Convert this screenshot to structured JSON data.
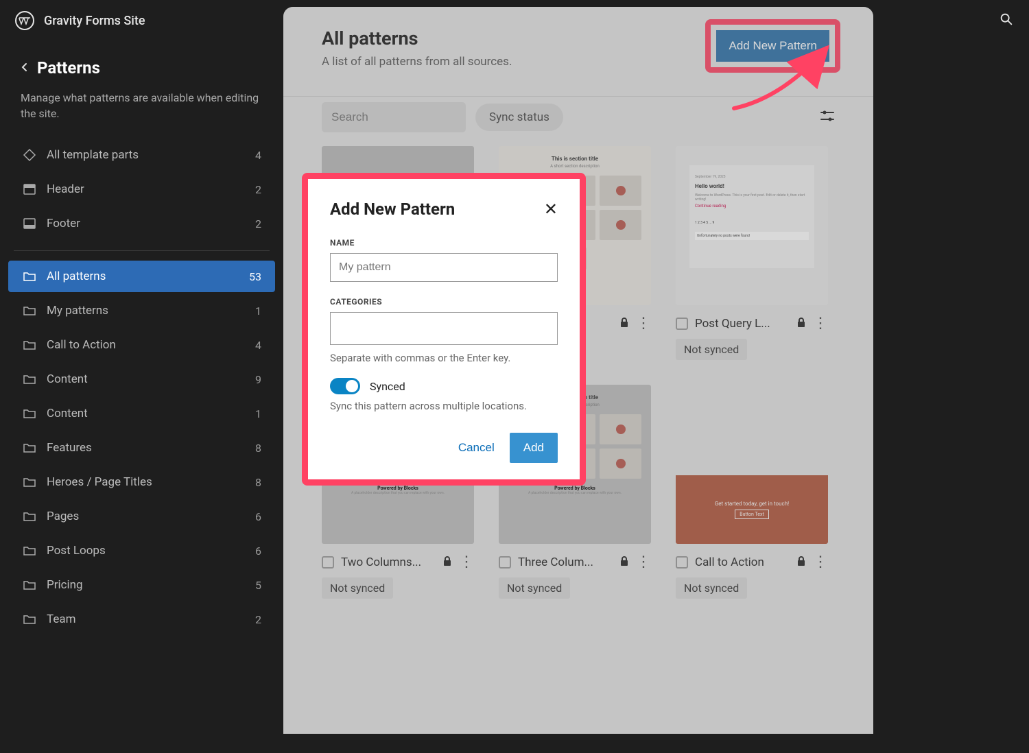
{
  "topbar": {
    "site_title": "Gravity Forms Site"
  },
  "sidebar": {
    "title": "Patterns",
    "description": "Manage what patterns are available when editing the site.",
    "groups": [
      {
        "icon": "diamond",
        "label": "All template parts",
        "count": 4
      },
      {
        "icon": "layout-header",
        "label": "Header",
        "count": 2
      },
      {
        "icon": "layout-footer",
        "label": "Footer",
        "count": 2
      }
    ],
    "categories": [
      {
        "label": "All patterns",
        "count": 53,
        "active": true
      },
      {
        "label": "My patterns",
        "count": 1
      },
      {
        "label": "Call to Action",
        "count": 4
      },
      {
        "label": "Content",
        "count": 9
      },
      {
        "label": "Content",
        "count": 1
      },
      {
        "label": "Features",
        "count": 8
      },
      {
        "label": "Heroes / Page Titles",
        "count": 8
      },
      {
        "label": "Pages",
        "count": 6
      },
      {
        "label": "Post Loops",
        "count": 6
      },
      {
        "label": "Pricing",
        "count": 5
      },
      {
        "label": "Team",
        "count": 2
      }
    ]
  },
  "header": {
    "title": "All patterns",
    "subtitle": "A list of all patterns from all sources.",
    "add_button": "Add New Pattern"
  },
  "filters": {
    "search_placeholder": "Search",
    "sync_status_label": "Sync status"
  },
  "cards": [
    {
      "name": "",
      "locked": false,
      "more": true,
      "badge": null,
      "thumb": "t1"
    },
    {
      "name": "",
      "locked": true,
      "more": true,
      "badge": null,
      "thumb": "t2"
    },
    {
      "name": "Post Query L...",
      "locked": true,
      "more": true,
      "badge": "Not synced",
      "thumb": "t3"
    },
    {
      "name": "Two Columns...",
      "locked": true,
      "more": true,
      "badge": "Not synced",
      "thumb": "t2b"
    },
    {
      "name": "Three Colum...",
      "locked": true,
      "more": true,
      "badge": "Not synced",
      "thumb": "t2c"
    },
    {
      "name": "Call to Action",
      "locked": true,
      "more": true,
      "badge": "Not synced",
      "thumb": "t4"
    }
  ],
  "modal": {
    "title": "Add New Pattern",
    "name_label": "Name",
    "name_placeholder": "My pattern",
    "categories_label": "Categories",
    "categories_help": "Separate with commas or the Enter key.",
    "synced_label": "Synced",
    "synced_desc": "Sync this pattern across multiple locations.",
    "cancel": "Cancel",
    "add": "Add"
  },
  "t4": {
    "cta_heading": "Get started today, get in touch!",
    "cta_button": "Button Text"
  }
}
